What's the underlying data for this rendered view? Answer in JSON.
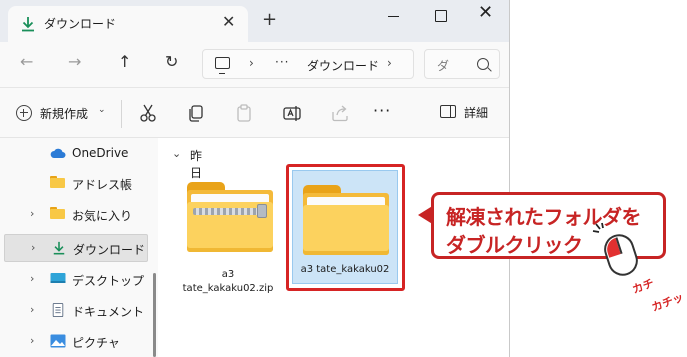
{
  "tab": {
    "title": "ダウンロード",
    "close": "✕",
    "new_tab": "+"
  },
  "window_controls": {
    "close": "✕"
  },
  "nav": {
    "back": "←",
    "forward": "→",
    "up": "↑",
    "refresh": "↻"
  },
  "address": {
    "sep1": "›",
    "ellipsis": "···",
    "current": "ダウンロード",
    "sep2": "›"
  },
  "search": {
    "placeholder": "ダ"
  },
  "command_bar": {
    "new_label": "新規作成",
    "new_chevron": "⌄",
    "more": "···",
    "details_label": "詳細"
  },
  "sidebar": {
    "items": [
      {
        "label": "OneDrive",
        "chevron": ""
      },
      {
        "label": "アドレス帳",
        "chevron": ""
      },
      {
        "label": "お気に入り",
        "chevron": "›"
      },
      {
        "label": "ダウンロード",
        "chevron": "›",
        "selected": true
      },
      {
        "label": "デスクトップ",
        "chevron": "›"
      },
      {
        "label": "ドキュメント",
        "chevron": "›"
      },
      {
        "label": "ピクチャ",
        "chevron": "›"
      }
    ]
  },
  "content": {
    "group": {
      "chevron": "⌄",
      "label": "昨日"
    },
    "files": [
      {
        "name_line1": "a3",
        "name_line2": "tate_kakaku02.zip",
        "type": "zip-folder"
      },
      {
        "name_line1": "a3 tate_kakaku02",
        "type": "folder",
        "selected": true
      }
    ]
  },
  "callout": {
    "line1": "解凍されたフォルダを",
    "line2": "ダブルクリック"
  },
  "sfx": {
    "click1": "カチ",
    "click2": "カチッ"
  },
  "colors": {
    "accent_red": "#d62424",
    "selection": "#cce4f7",
    "folder": "#f8c846"
  }
}
